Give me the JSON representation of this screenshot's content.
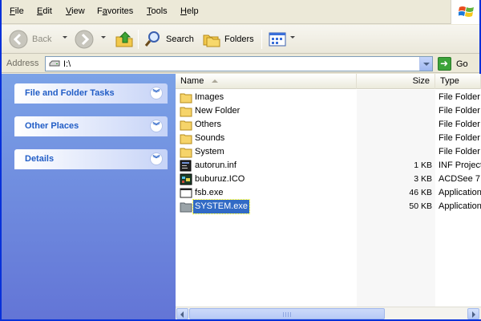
{
  "menu": {
    "file": {
      "u": "F",
      "rest": "ile"
    },
    "edit": {
      "u": "E",
      "rest": "dit"
    },
    "view": {
      "u": "V",
      "rest": "iew"
    },
    "favorites": {
      "pre": "F",
      "u": "a",
      "rest": "vorites"
    },
    "tools": {
      "u": "T",
      "rest": "ools"
    },
    "help": {
      "u": "H",
      "rest": "elp"
    }
  },
  "toolbar": {
    "back_label": "Back",
    "search_label": "Search",
    "folders_label": "Folders"
  },
  "address": {
    "label": "Address",
    "value": "I:\\",
    "go_label": "Go"
  },
  "left_panels": [
    {
      "title": "File and Folder Tasks"
    },
    {
      "title": "Other Places"
    },
    {
      "title": "Details"
    }
  ],
  "columns": {
    "name": "Name",
    "size": "Size",
    "type": "Type"
  },
  "files": [
    {
      "name": "Images",
      "size": "",
      "type": "File Folder",
      "icon": "folder-icon"
    },
    {
      "name": "New Folder",
      "size": "",
      "type": "File Folder",
      "icon": "folder-icon"
    },
    {
      "name": "Others",
      "size": "",
      "type": "File Folder",
      "icon": "folder-icon"
    },
    {
      "name": "Sounds",
      "size": "",
      "type": "File Folder",
      "icon": "folder-icon"
    },
    {
      "name": "System",
      "size": "",
      "type": "File Folder",
      "icon": "folder-icon"
    },
    {
      "name": "autorun.inf",
      "size": "1 KB",
      "type": "INF Project",
      "icon": "inf-file-icon"
    },
    {
      "name": "buburuz.ICO",
      "size": "3 KB",
      "type": "ACDSee 7",
      "icon": "ico-file-icon"
    },
    {
      "name": "fsb.exe",
      "size": "46 KB",
      "type": "Application",
      "icon": "exe-file-icon"
    },
    {
      "name": "SYSTEM.exe",
      "size": "50 KB",
      "type": "Application",
      "icon": "folder-exe-icon",
      "selected": true
    }
  ]
}
